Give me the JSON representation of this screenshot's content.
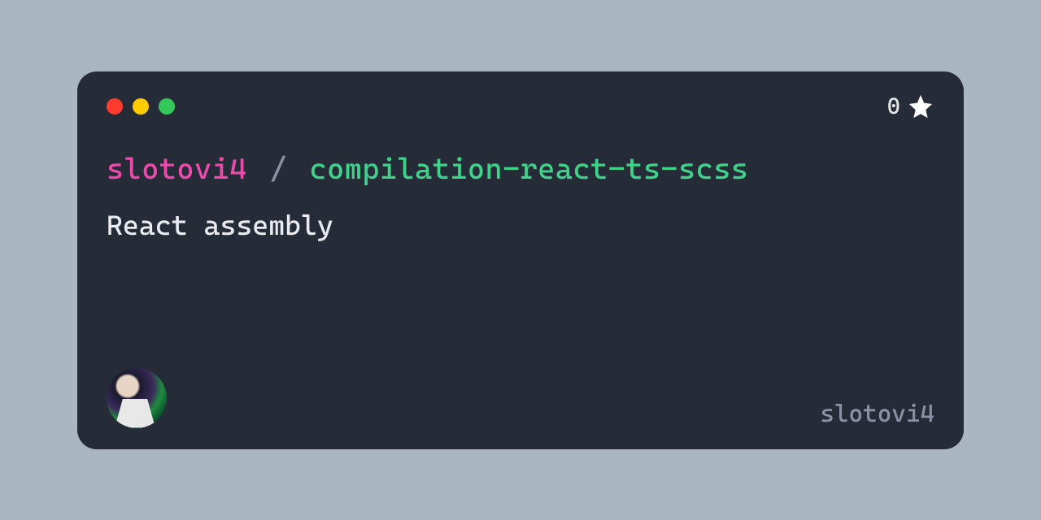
{
  "owner": "slotovi4",
  "separator": "/",
  "repo": "compilation-react-ts-scss",
  "description": "React assembly",
  "stars": "0",
  "username": "slotovi4"
}
